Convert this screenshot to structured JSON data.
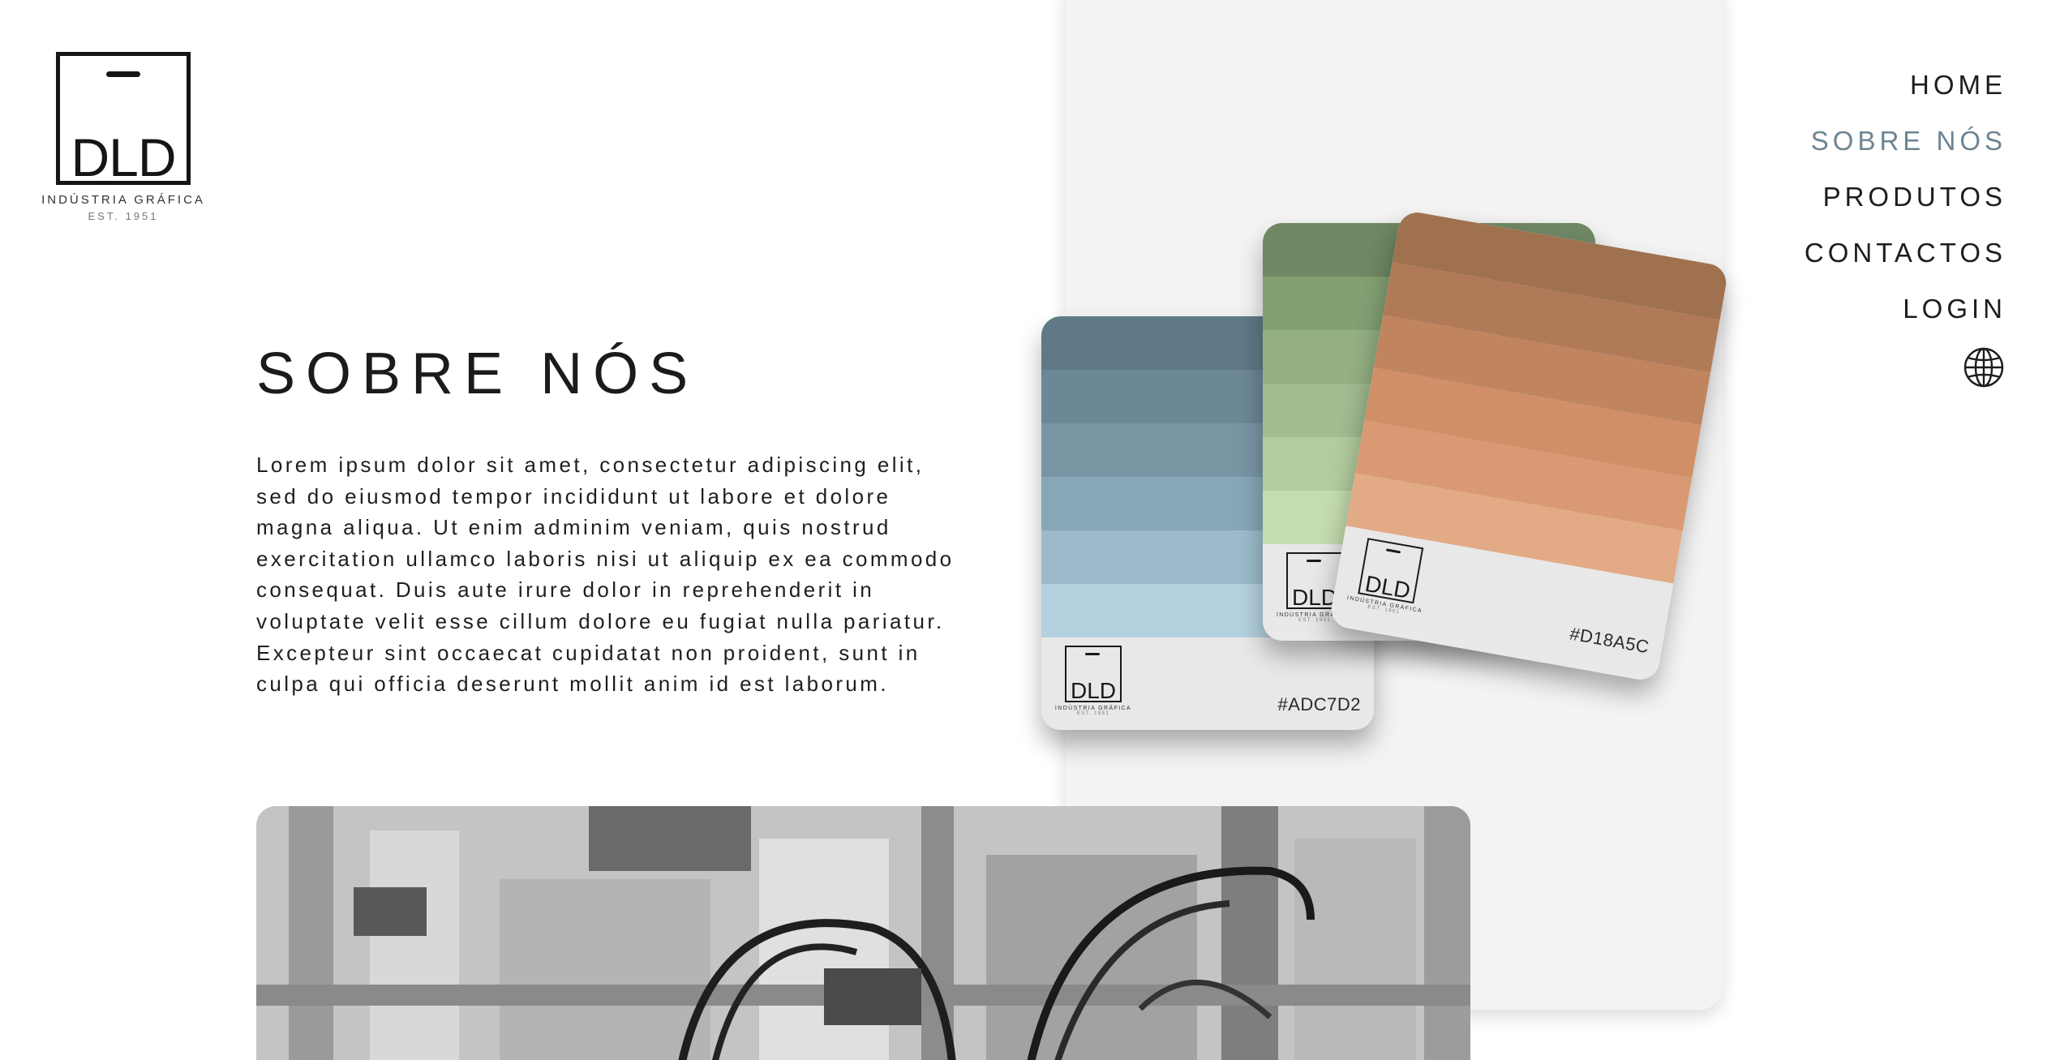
{
  "brand": {
    "logo_text": "DLD",
    "subtitle": "INDÚSTRIA GRÁFICA",
    "est": "EST. 1951"
  },
  "nav": {
    "items": [
      {
        "label": "HOME",
        "active": false
      },
      {
        "label": "SOBRE NÓS",
        "active": true
      },
      {
        "label": "PRODUTOS",
        "active": false
      },
      {
        "label": "CONTACTOS",
        "active": false
      },
      {
        "label": "LOGIN",
        "active": false
      }
    ],
    "language_icon": "globe-icon",
    "active_color": "#6d8493"
  },
  "about": {
    "title": "SOBRE NÓS",
    "body": "Lorem ipsum dolor sit amet, consectetur adipiscing elit, sed do eiusmod tempor incididunt ut labore et dolore magna aliqua. Ut enim adminim veniam, quis nostrud exercitation ullamco laboris nisi ut aliquip ex ea commodo consequat. Duis aute irure dolor in reprehenderit in voluptate velit esse cillum dolore eu fugiat nulla pariatur. Excepteur sint occaecat cupidatat non proident, sunt in culpa qui officia deserunt mollit anim id est laborum."
  },
  "swatches": [
    {
      "hex": "#ADC7D2",
      "stripes": [
        "#5f7987",
        "#6c8796",
        "#7895a4",
        "#87a6b6",
        "#9cbacb",
        "#b3d1de"
      ]
    },
    {
      "hex": "",
      "stripes": [
        "#6f8764",
        "#83a074",
        "#94b083",
        "#a2bc91",
        "#b3cc9f",
        "#c5dcb0"
      ]
    },
    {
      "hex": "#D18A5C",
      "stripes": [
        "#a0714f",
        "#b07a58",
        "#c0845f",
        "#d08f67",
        "#d99a73",
        "#e3aa86"
      ]
    }
  ],
  "photo": {
    "icon": "industrial-printing-machine-photo"
  }
}
